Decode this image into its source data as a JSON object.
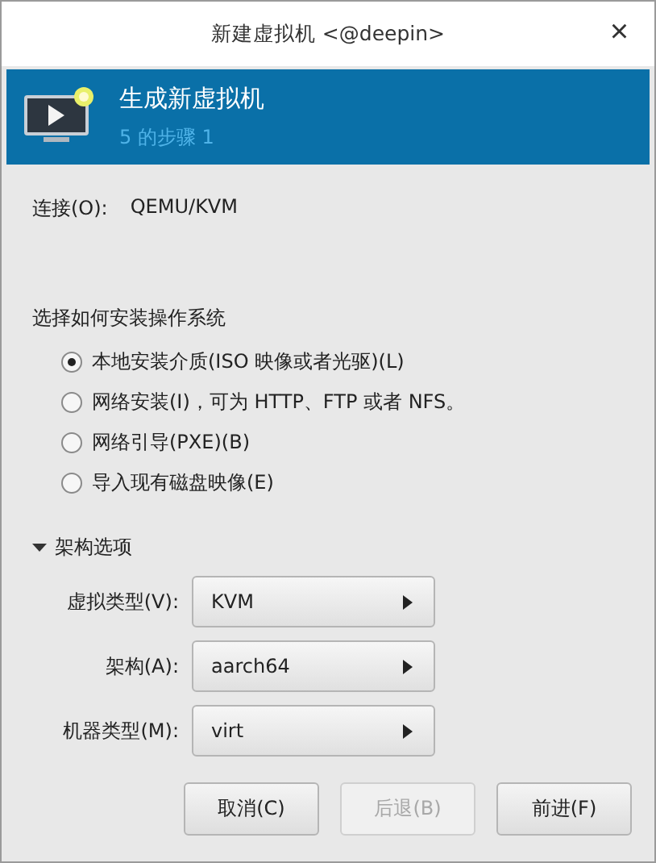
{
  "window": {
    "title": "新建虚拟机 <@deepin>",
    "close": "×"
  },
  "banner": {
    "title": "生成新虚拟机",
    "subtitle": "5 的步骤 1"
  },
  "connection": {
    "label": "连接(O):",
    "value": "QEMU/KVM"
  },
  "install": {
    "heading": "选择如何安装操作系统",
    "options": [
      {
        "label": "本地安装介质(ISO 映像或者光驱)(L)",
        "selected": true
      },
      {
        "label": "网络安装(I)，可为 HTTP、FTP 或者 NFS。",
        "selected": false
      },
      {
        "label": "网络引导(PXE)(B)",
        "selected": false
      },
      {
        "label": "导入现有磁盘映像(E)",
        "selected": false
      }
    ]
  },
  "arch_options": {
    "label": "架构选项",
    "expanded": true,
    "fields": [
      {
        "label": "虚拟类型(V):",
        "value": "KVM"
      },
      {
        "label": "架构(A):",
        "value": "aarch64"
      },
      {
        "label": "机器类型(M):",
        "value": "virt"
      }
    ]
  },
  "buttons": [
    {
      "label": "取消(C)",
      "disabled": false
    },
    {
      "label": "后退(B)",
      "disabled": true
    },
    {
      "label": "前进(F)",
      "disabled": false
    }
  ]
}
